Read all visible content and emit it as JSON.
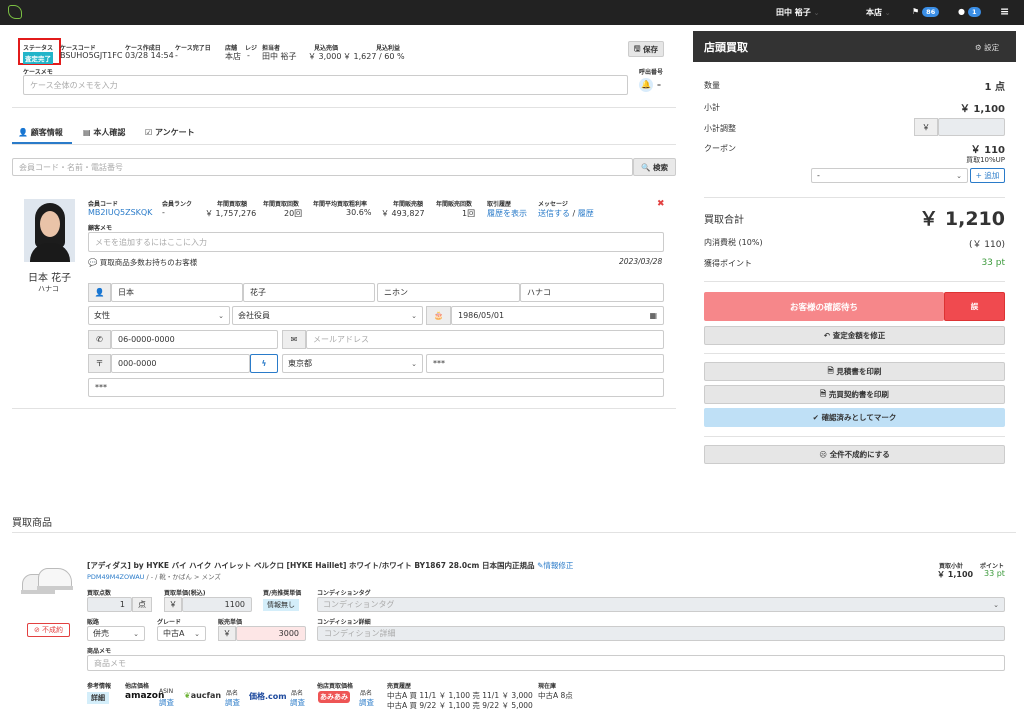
{
  "topbar": {
    "user": "田中 裕子",
    "store": "本店",
    "flag_count": "86",
    "msg_count": "1"
  },
  "case": {
    "status_label": "ステータス",
    "status_value": "査定完了",
    "code_label": "ケースコード",
    "code_value": "BSUHO5GJT1FC",
    "created_label": "ケース作成日",
    "created_value": "03/28 14:54",
    "ended_label": "ケース完了日",
    "ended_value": "-",
    "store_label": "店舗",
    "store_value": "本店",
    "register_label": "レジ",
    "register_value": "-",
    "staff_label": "担当者",
    "staff_value": "田中 裕子",
    "est_sales_label": "見込売価",
    "est_sales_value": "￥ 3,000",
    "est_profit_label": "見込利益",
    "est_profit_value": "￥ 1,627 / 60 %",
    "save_label": "保存",
    "memo_label": "ケースメモ",
    "memo_placeholder": "ケース全体のメモを入力",
    "call_label": "呼出番号",
    "call_value": "–"
  },
  "tabs": {
    "customer": "顧客情報",
    "identity": "本人確認",
    "survey": "アンケート"
  },
  "search": {
    "placeholder": "会員コード・名前・電話番号",
    "button": "検索"
  },
  "customer": {
    "name": "日本 花子",
    "kana": "ハナコ",
    "member_code_label": "会員コード",
    "member_code": "MB2IUQ5ZSKQK",
    "rank_label": "会員ランク",
    "rank": "-",
    "annual_amount_label": "年間買取額",
    "annual_amount": "￥ 1,757,276",
    "annual_count_label": "年間買取回数",
    "annual_count": "20回",
    "avg_rate_label": "年間平均買取粗利率",
    "avg_rate": "30.6%",
    "annual_sales_label": "年間販売額",
    "annual_sales": "￥ 493,827",
    "annual_sales_count_label": "年間販売回数",
    "annual_sales_count": "1回",
    "history_label": "取引履歴",
    "history_link": "履歴を表示",
    "message_label": "メッセージ",
    "message_send": "送信する",
    "message_sep": "/",
    "message_history": "履歴",
    "memo_label": "顧客メモ",
    "memo_placeholder": "メモを追加するにはここに入力",
    "note": "買取商品多数お持ちのお客様",
    "note_date": "2023/03/28",
    "last_name": "日本",
    "first_name": "花子",
    "last_kana": "ニホン",
    "first_kana": "ハナコ",
    "gender": "女性",
    "job": "会社役員",
    "birthday": "1986/05/01",
    "phone": "06-0000-0000",
    "email_placeholder": "メールアドレス",
    "zip": "000-0000",
    "prefecture": "東京都",
    "address1": "***",
    "address2": "***"
  },
  "right": {
    "title": "店頭買取",
    "settings": "設定",
    "qty_label": "数量",
    "qty_value": "1 点",
    "subtotal_label": "小計",
    "subtotal_value": "￥ 1,100",
    "adjust_label": "小計調整",
    "adjust_addon": "￥",
    "coupon_label": "クーポン",
    "coupon_value": "￥ 110",
    "coupon_note": "買取10%UP",
    "coupon_select": "-",
    "coupon_add": "+ 追加",
    "total_label": "買取合計",
    "total_value": "￥ 1,210",
    "tax_label": "内消費税 (10%)",
    "tax_value": "(￥ 110)",
    "points_label": "獲得ポイント",
    "points_value": "33 pt",
    "wait_button": "お客様の確認待ち",
    "side_button": "誤",
    "fix_button": "査定金額を修正",
    "estimate_button": "見積書を印刷",
    "contract_button": "売買契約書を印刷",
    "confirm_button": "確認済みとしてマーク",
    "fail_button": "全件不成約にする"
  },
  "items": {
    "section_title": "買取商品",
    "item": {
      "title": "[アディダス] by HYKE バイ ハイク ハイレット ベルクロ [HYKE Haillet] ホワイト/ホワイト BY1867 28.0cm 日本国内正規品",
      "edit_link": "情報修正",
      "code": "PDM49M4ZOWAU",
      "category": "/ - / 靴・かばん > メンズ",
      "status_badge": "不成約",
      "subtotal_label": "買取小計",
      "subtotal_value": "￥ 1,100",
      "point_label": "ポイント",
      "point_value": "33 pt",
      "qty_label": "買取点数",
      "qty_value": "1",
      "qty_unit": "点",
      "unit_price_label": "買取単価(税込)",
      "unit_price_addon": "￥",
      "unit_price_value": "1100",
      "ref_label": "買/売推奨単価",
      "ref_value": "情報無し",
      "cond_tag_label": "コンディションタグ",
      "cond_tag_placeholder": "コンディションタグ",
      "route_label": "販路",
      "route_value": "併売",
      "grade_label": "グレード",
      "grade_value": "中古A",
      "sale_price_label": "販売単価",
      "sale_price_addon": "￥",
      "sale_price_value": "3000",
      "cond_detail_label": "コンディション詳細",
      "cond_detail_placeholder": "コンディション詳細",
      "memo_label": "商品メモ",
      "memo_placeholder": "商品メモ",
      "ref_info_label": "参考情報",
      "ref_info_button": "詳細",
      "other_price_label": "他店価格",
      "amazon": "amazon",
      "asin_label": "ASIN",
      "aucfan": "aucfan",
      "kakaku": "価格.com",
      "product_name_label": "品名",
      "survey_link": "調査",
      "other_buy_label": "他店買取価格",
      "omamori": "あみあみ",
      "history_label": "売買履歴",
      "history1": "中古A 買 11/1 ￥ 1,100 売 11/1 ￥ 3,000",
      "history2": "中古A 買 9/22 ￥ 1,100 売 9/22 ￥ 5,000",
      "stock_label": "現在庫",
      "stock_value": "中古A 8点"
    }
  }
}
